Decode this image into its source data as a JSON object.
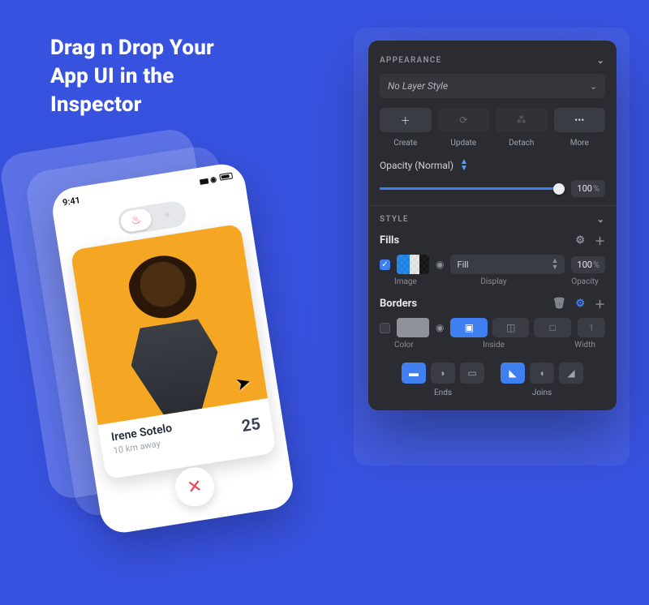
{
  "headline": {
    "l1": "Drag n Drop Your",
    "l2": "App UI in the",
    "l3": "Inspector"
  },
  "phone": {
    "time": "9:41",
    "card": {
      "name": "Irene Sotelo",
      "distance": "10 km away",
      "age": "25"
    }
  },
  "inspector": {
    "appearance": {
      "title": "APPEARANCE",
      "layer_style": "No Layer Style",
      "buttons": {
        "create": "Create",
        "update": "Update",
        "detach": "Detach",
        "more": "More"
      },
      "opacity_label": "Opacity (Normal)",
      "opacity_value": "100",
      "opacity_pct": 100
    },
    "style": {
      "title": "STYLE",
      "fills": {
        "title": "Fills",
        "display_mode": "Fill",
        "opacity_value": "100",
        "labels": {
          "image": "Image",
          "display": "Display",
          "opacity": "Opacity"
        }
      },
      "borders": {
        "title": "Borders",
        "width_value": "1",
        "position": "Inside",
        "labels": {
          "color": "Color",
          "position": "Inside",
          "width": "Width"
        }
      },
      "ends_label": "Ends",
      "joins_label": "Joins"
    }
  }
}
